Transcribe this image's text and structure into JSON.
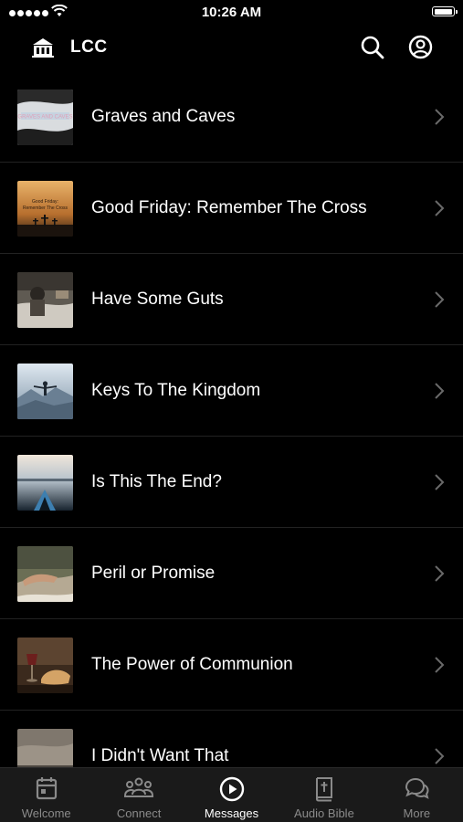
{
  "status_bar": {
    "time": "10:26 AM"
  },
  "header": {
    "title": "LCC"
  },
  "messages": [
    {
      "title": "Graves and Caves",
      "thumb_text": "GRAVES AND CAVES",
      "colors": [
        "#e8e8e8",
        "#b9c4cf"
      ]
    },
    {
      "title": "Good Friday: Remember The Cross",
      "thumb_text": "Good Friday: Remember The Cross",
      "colors": [
        "#c9893c",
        "#3b2b1e"
      ]
    },
    {
      "title": "Have Some Guts",
      "thumb_text": "",
      "colors": [
        "#6d6a63",
        "#d7d4cd"
      ]
    },
    {
      "title": "Keys To The Kingdom",
      "thumb_text": "",
      "colors": [
        "#c6d6e4",
        "#5d7488"
      ]
    },
    {
      "title": "Is This The End?",
      "thumb_text": "",
      "colors": [
        "#e6dcd0",
        "#1f2f3d"
      ]
    },
    {
      "title": "Peril or Promise",
      "thumb_text": "",
      "colors": [
        "#5c6147",
        "#a89c86"
      ]
    },
    {
      "title": "The Power of Communion",
      "thumb_text": "",
      "colors": [
        "#7a5b3e",
        "#2e2016"
      ]
    },
    {
      "title": "I Didn't Want That",
      "thumb_text": "",
      "colors": [
        "#8a8278",
        "#4b463f"
      ]
    }
  ],
  "tabs": [
    {
      "label": "Welcome",
      "icon": "calendar-icon"
    },
    {
      "label": "Connect",
      "icon": "people-icon"
    },
    {
      "label": "Messages",
      "icon": "play-circle-icon"
    },
    {
      "label": "Audio Bible",
      "icon": "bible-icon"
    },
    {
      "label": "More",
      "icon": "chat-bubbles-icon"
    }
  ]
}
